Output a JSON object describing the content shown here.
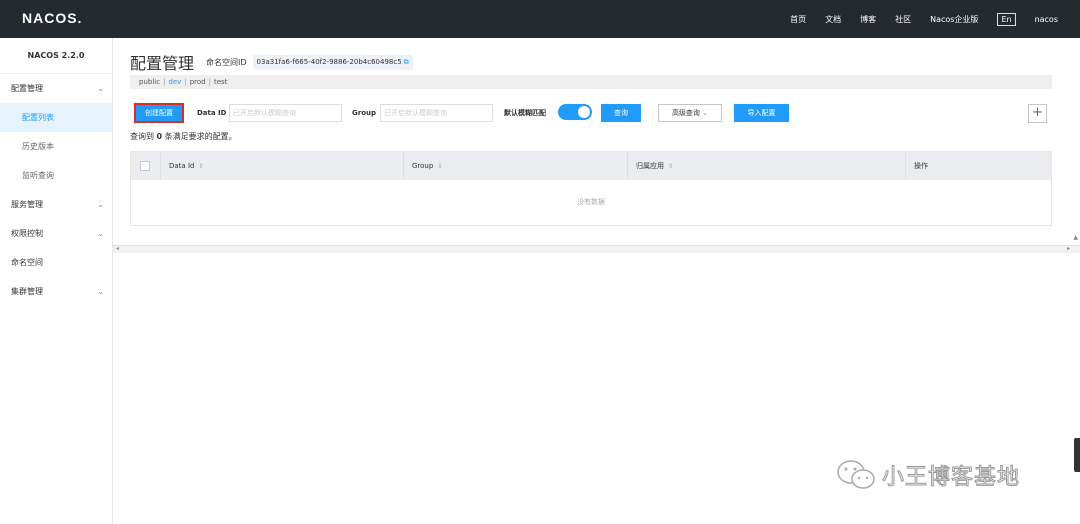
{
  "header": {
    "logo": "NACOS.",
    "nav": [
      "首页",
      "文档",
      "博客",
      "社区",
      "Nacos企业版"
    ],
    "lang": "En",
    "user": "nacos"
  },
  "sidebar": {
    "version": "NACOS 2.2.0",
    "items": [
      {
        "label": "配置管理",
        "expandable": true
      },
      {
        "label": "配置列表",
        "active": true
      },
      {
        "label": "历史版本"
      },
      {
        "label": "监听查询"
      },
      {
        "label": "服务管理",
        "expandable": true
      },
      {
        "label": "权限控制",
        "expandable": true
      },
      {
        "label": "命名空间"
      },
      {
        "label": "集群管理",
        "expandable": true
      }
    ]
  },
  "main": {
    "title": "配置管理",
    "namespace_label": "命名空间ID",
    "namespace_id": "03a31fa6-f665-40f2-9886-20b4c60498c5",
    "namespaces": [
      "public",
      "dev",
      "prod",
      "test"
    ],
    "active_namespace": "dev",
    "toolbar": {
      "create_label": "创建配置",
      "dataid_label": "Data ID",
      "dataid_placeholder": "已开启默认模糊查询",
      "group_label": "Group",
      "group_placeholder": "已开启默认模糊查询",
      "fuzzy_label": "默认模糊匹配",
      "fuzzy_on": true,
      "query_label": "查询",
      "advanced_label": "高级查询",
      "import_label": "导入配置"
    },
    "result_prefix": "查询到",
    "result_count": "0",
    "result_suffix": "条满足要求的配置。",
    "table": {
      "columns": [
        "Data Id",
        "Group",
        "归属应用",
        "操作"
      ],
      "empty_text": "没有数据"
    }
  },
  "watermark": "小王博客基地",
  "colors": {
    "primary": "#209bfa",
    "topbar": "#252a2f",
    "highlight": "#e02b2b"
  }
}
